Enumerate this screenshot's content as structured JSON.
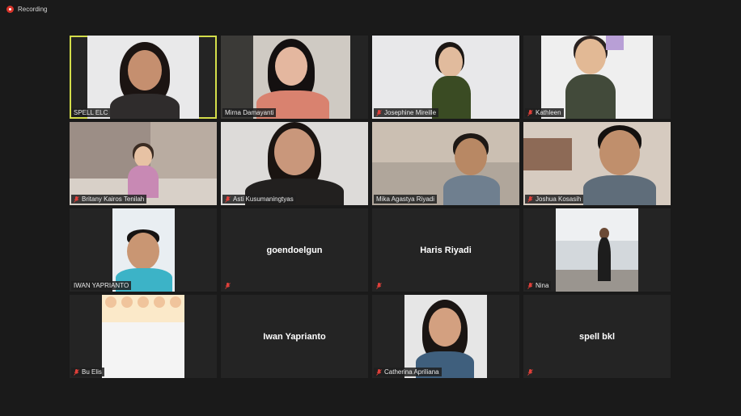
{
  "recording": {
    "label": "Recording"
  },
  "participants": [
    {
      "name": "SPELL ELC",
      "muted": false,
      "active": true
    },
    {
      "name": "Mirna Damayanti",
      "muted": false
    },
    {
      "name": "Josephine Mireille",
      "muted": true
    },
    {
      "name": "Kathleen",
      "muted": true
    },
    {
      "name": "Britany Kairos Tenilah",
      "muted": true
    },
    {
      "name": "Asti Kusumaningtyas",
      "muted": true
    },
    {
      "name": "Mika Agastya Riyadi",
      "muted": false
    },
    {
      "name": "Joshua Kosasih",
      "muted": true
    },
    {
      "name": "IWAN YAPRIANTO",
      "muted": false
    },
    {
      "name": "goendoelgun",
      "muted": true
    },
    {
      "name": "Haris Riyadi",
      "muted": true
    },
    {
      "name": "Nina",
      "muted": true
    },
    {
      "name": "Bu Elis",
      "muted": true
    },
    {
      "name": "Iwan Yaprianto",
      "muted": false
    },
    {
      "name": "Catherina Apriliana",
      "muted": true
    },
    {
      "name": "spell bkl",
      "muted": true
    }
  ],
  "colors": {
    "active_border": "#d3dd4a",
    "record_red": "#d9352b",
    "mute_red": "#e0403a"
  }
}
